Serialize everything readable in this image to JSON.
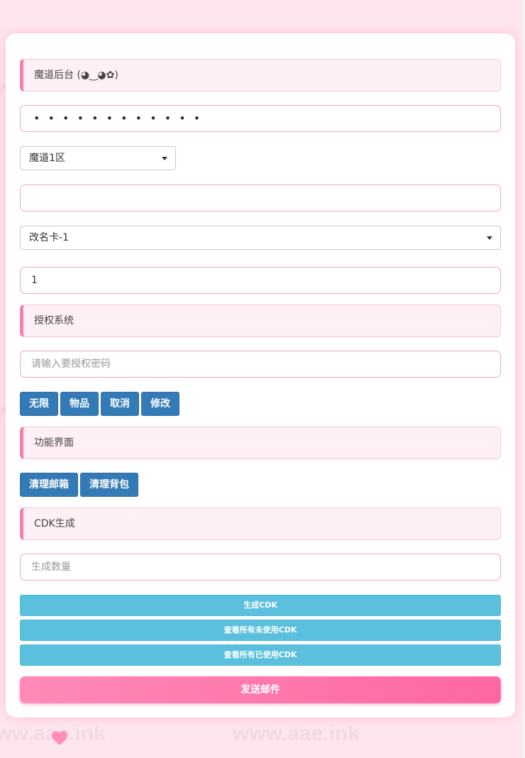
{
  "watermark_text": "www.aae.ink",
  "panel": {
    "title": "魔道后台 (◕‿◕✿)",
    "password_mask": "• • • • • • • • • • • •",
    "server_select": "魔道1区",
    "role_input_value": "",
    "item_select": "改名卡-1",
    "quantity_value": "1"
  },
  "auth": {
    "title": "授权系统",
    "password_placeholder": "请输入要授权密码",
    "buttons": [
      "无限",
      "物品",
      "取消",
      "修改"
    ]
  },
  "functions": {
    "title": "功能界面",
    "buttons": [
      "清理邮箱",
      "清理背包"
    ]
  },
  "cdk": {
    "title": "CDK生成",
    "count_placeholder": "生成数量",
    "generate_label": "生成CDK",
    "view_unused_label": "查看所有未使用CDK",
    "view_used_label": "查看所有已使用CDK"
  },
  "send_label": "发送邮件",
  "colors": {
    "accent_pink": "#f77fb0",
    "primary_blue": "#337ab7",
    "info_cyan": "#5bc0de",
    "send_gradient_end": "#ff67a2"
  }
}
